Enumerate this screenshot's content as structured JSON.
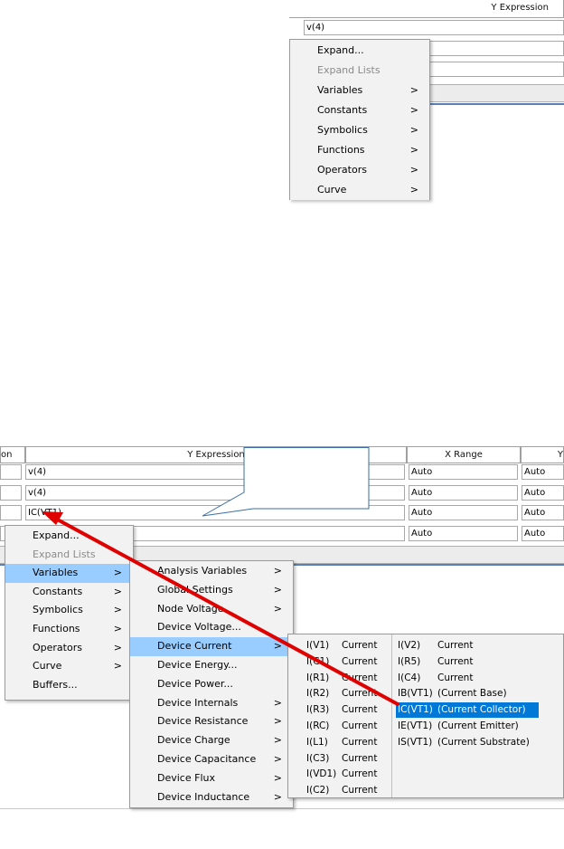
{
  "top": {
    "header": "Y Expression",
    "cell_value": "v(4)",
    "menu": [
      {
        "label": "Expand...",
        "arrow": ""
      },
      {
        "label": "Expand Lists",
        "arrow": "",
        "disabled": true
      },
      {
        "label": "Variables",
        "arrow": ">"
      },
      {
        "label": "Constants",
        "arrow": ">"
      },
      {
        "label": "Symbolics",
        "arrow": ">"
      },
      {
        "label": "Functions",
        "arrow": ">"
      },
      {
        "label": "Operators",
        "arrow": ">"
      },
      {
        "label": "Curve",
        "arrow": ">"
      }
    ]
  },
  "bottom": {
    "headers": {
      "left": "on",
      "y_expression": "Y Expression",
      "x_range": "X Range",
      "y_range": "Y"
    },
    "rows": [
      {
        "y": "v(4)",
        "x": "Auto",
        "r": "Auto"
      },
      {
        "y": "v(4)",
        "x": "Auto",
        "r": "Auto"
      },
      {
        "y": "IC(VT1)",
        "x": "Auto",
        "r": "Auto"
      },
      {
        "y": "",
        "x": "Auto",
        "r": "Auto"
      }
    ],
    "menu1": [
      {
        "label": "Expand...",
        "arrow": ""
      },
      {
        "label": "Expand Lists",
        "arrow": "",
        "disabled": true
      },
      {
        "label": "Variables",
        "arrow": ">",
        "selected": true
      },
      {
        "label": "Constants",
        "arrow": ">"
      },
      {
        "label": "Symbolics",
        "arrow": ">"
      },
      {
        "label": "Functions",
        "arrow": ">"
      },
      {
        "label": "Operators",
        "arrow": ">"
      },
      {
        "label": "Curve",
        "arrow": ">"
      },
      {
        "label": "Buffers...",
        "arrow": ""
      }
    ],
    "menu2": [
      {
        "label": "Analysis Variables",
        "arrow": ">"
      },
      {
        "label": "Global Settings",
        "arrow": ">"
      },
      {
        "label": "Node Voltage",
        "arrow": ">"
      },
      {
        "label": "Device Voltage...",
        "arrow": ""
      },
      {
        "label": "Device Current",
        "arrow": ">",
        "selected": true
      },
      {
        "label": "Device Energy...",
        "arrow": ""
      },
      {
        "label": "Device Power...",
        "arrow": ""
      },
      {
        "label": "Device Internals",
        "arrow": ">"
      },
      {
        "label": "Device Resistance",
        "arrow": ">"
      },
      {
        "label": "Device Charge",
        "arrow": ">"
      },
      {
        "label": "Device Capacitance",
        "arrow": ">"
      },
      {
        "label": "Device Flux",
        "arrow": ">"
      },
      {
        "label": "Device Inductance",
        "arrow": ">"
      }
    ],
    "menu3_col1": [
      {
        "name": "I(V1)",
        "desc": "Current"
      },
      {
        "name": "I(C1)",
        "desc": "Current"
      },
      {
        "name": "I(R1)",
        "desc": "Current"
      },
      {
        "name": "I(R2)",
        "desc": "Current"
      },
      {
        "name": "I(R3)",
        "desc": "Current"
      },
      {
        "name": "I(RC)",
        "desc": "Current"
      },
      {
        "name": "I(L1)",
        "desc": "Current"
      },
      {
        "name": "I(C3)",
        "desc": "Current"
      },
      {
        "name": "I(VD1)",
        "desc": "Current"
      },
      {
        "name": "I(C2)",
        "desc": "Current"
      }
    ],
    "menu3_col2": [
      {
        "name": "I(V2)",
        "desc": "Current"
      },
      {
        "name": "I(R5)",
        "desc": "Current"
      },
      {
        "name": "I(C4)",
        "desc": "Current"
      },
      {
        "name": "IB(VT1)",
        "desc": "(Current Base)"
      },
      {
        "name": "IC(VT1)",
        "desc": "(Current Collector)",
        "selected": true
      },
      {
        "name": "IE(VT1)",
        "desc": "(Current Emitter)"
      },
      {
        "name": "IS(VT1)",
        "desc": "(Current Substrate)"
      }
    ]
  },
  "colors": {
    "menu_bg": "#f2f2f2",
    "menu_selected": "#99ccff",
    "item_selected": "#0078d7",
    "arrow": "#e00000",
    "callout": "#3a6ea5"
  }
}
